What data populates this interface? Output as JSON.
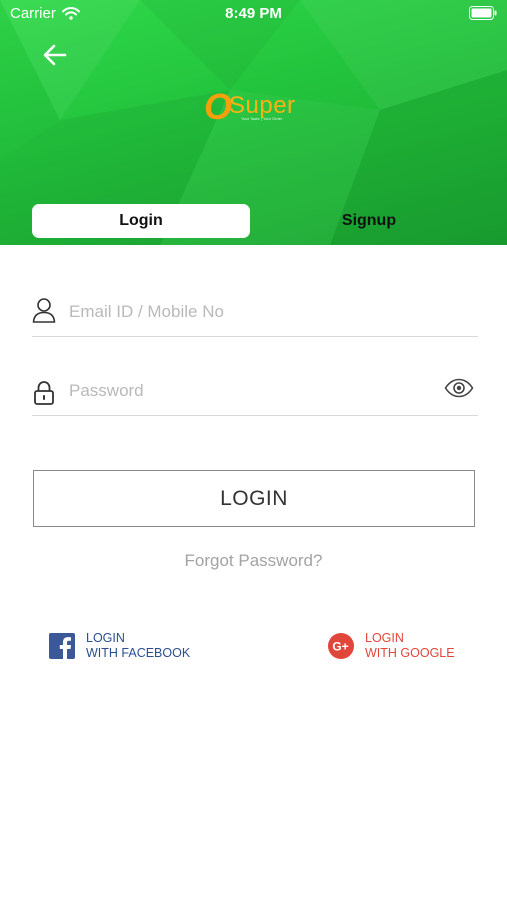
{
  "status_bar": {
    "carrier": "Carrier",
    "time": "8:49 PM"
  },
  "header": {
    "back_icon": "arrow-left-icon",
    "logo": {
      "mark": "O",
      "name": "Super",
      "tagline": "Your Taste | Your Order"
    }
  },
  "tabs": [
    {
      "label": "Login",
      "active": true
    },
    {
      "label": "Signup",
      "active": false
    }
  ],
  "form": {
    "email": {
      "placeholder": "Email ID / Mobile No",
      "value": "",
      "icon": "user-icon"
    },
    "password": {
      "placeholder": "Password",
      "value": "",
      "icon": "lock-icon",
      "toggle_icon": "eye-icon"
    },
    "login_button": "LOGIN",
    "forgot_link": "Forgot Password?"
  },
  "social": {
    "facebook": {
      "line1": "LOGIN",
      "line2": "WITH FACEBOOK",
      "icon": "facebook-icon"
    },
    "google": {
      "line1": "LOGIN",
      "line2": "WITH GOOGLE",
      "icon": "google-plus-icon"
    }
  },
  "colors": {
    "header_green": "#22c23c",
    "accent_orange": "#f5a00a",
    "facebook_blue": "#2a4f8f",
    "google_red": "#e0473a"
  }
}
